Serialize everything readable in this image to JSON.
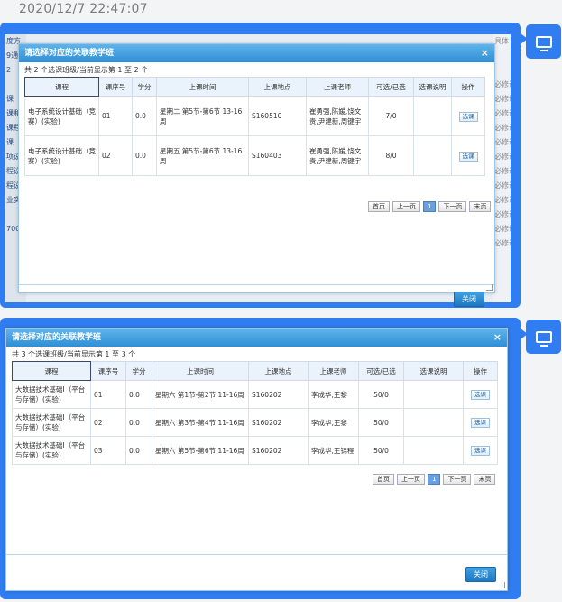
{
  "timestamp": "2020/12/7 22:47:07",
  "messages": [
    {
      "background": {
        "left": [
          "度方",
          "9通",
          "2",
          "",
          "课",
          "课和",
          "课程",
          "课",
          "项设",
          "程设",
          "程设",
          "业实",
          "",
          "700"
        ],
        "right": [
          "具体",
          "",
          "",
          "必修课",
          "必修课",
          "必修课",
          "必修课",
          "必修课",
          "必修课",
          "必修课",
          "必修课",
          "必修课",
          "必修课",
          "必修课",
          "必修课"
        ]
      },
      "dialog": {
        "title": "请选择对应的关联教学班",
        "info": "共 2 个选课班级/当前显示第 1 至 2 个",
        "headers": [
          "课程",
          "课序号",
          "学分",
          "上课时间",
          "上课地点",
          "上课老师",
          "可选/已选",
          "选课说明",
          "操作"
        ],
        "rows": [
          {
            "course": "电子系统设计基础（竞赛）(实验)",
            "seq": "01",
            "credit": "0.0",
            "time": "星期二 第5节-第6节 13-16周",
            "place": "S160510",
            "teacher": "崔勇强,陈媛,饶文贵,尹建新,周键宇",
            "avail": "7/0",
            "note": "",
            "op": "选课"
          },
          {
            "course": "电子系统设计基础（竞赛）(实验)",
            "seq": "02",
            "credit": "0.0",
            "time": "星期五 第5节-第6节 13-16周",
            "place": "S160403",
            "teacher": "崔勇强,陈媛,饶文贵,尹建新,周键宇",
            "avail": "8/0",
            "note": "",
            "op": "选课"
          }
        ],
        "pager": [
          "首页",
          "上一页",
          "1",
          "下一页",
          "末页"
        ],
        "ok": "关闭"
      }
    },
    {
      "dialog": {
        "title": "请选择对应的关联教学班",
        "info": "共 3 个选课班级/当前显示第 1 至 3 个",
        "headers": [
          "课程",
          "课序号",
          "学分",
          "上课时间",
          "上课地点",
          "上课老师",
          "可选/已选",
          "选课说明",
          "操作"
        ],
        "rows": [
          {
            "course": "大数据技术基础I（平台与存储）(实验)",
            "seq": "01",
            "credit": "0.0",
            "time": "星期六 第1节-第2节 11-16周",
            "place": "S160202",
            "teacher": "李成华,王黎",
            "avail": "50/0",
            "note": "",
            "op": "选课"
          },
          {
            "course": "大数据技术基础I（平台与存储）(实验)",
            "seq": "02",
            "credit": "0.0",
            "time": "星期六 第3节-第4节 11-16周",
            "place": "S160202",
            "teacher": "李成华,王黎",
            "avail": "50/0",
            "note": "",
            "op": "选课"
          },
          {
            "course": "大数据技术基础I（平台与存储）(实验)",
            "seq": "03",
            "credit": "0.0",
            "time": "星期六 第5节-第6节 11-16周",
            "place": "S160202",
            "teacher": "李成华,王锦程",
            "avail": "50/0",
            "note": "",
            "op": "选课"
          }
        ],
        "pager": [
          "首页",
          "上一页",
          "1",
          "下一页",
          "末页"
        ],
        "ok": "关闭"
      }
    }
  ]
}
